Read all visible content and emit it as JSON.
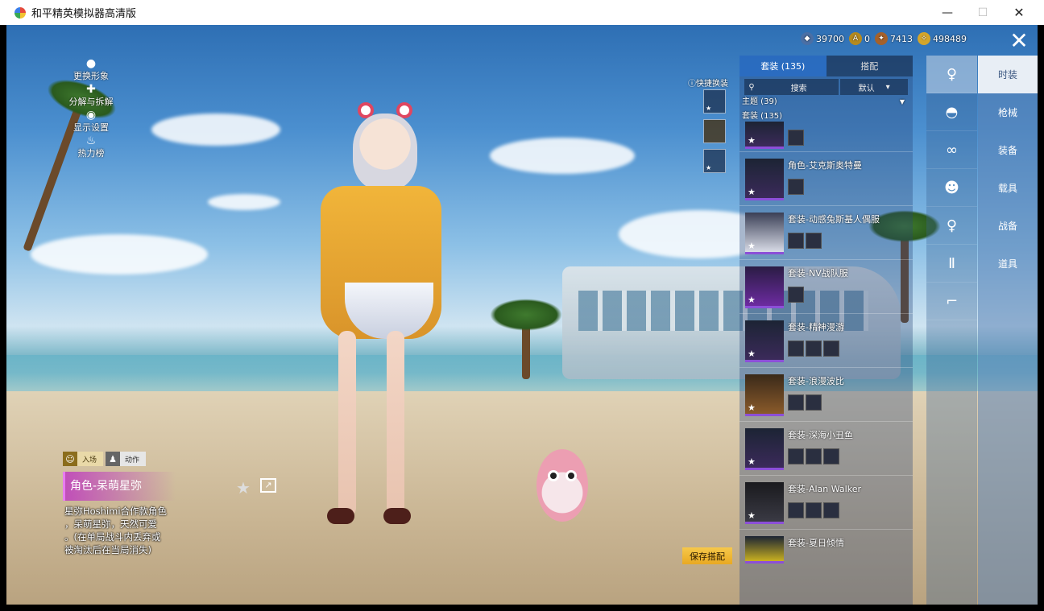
{
  "window": {
    "title": "和平精英模拟器高清版",
    "min_label": "—",
    "max_label": "☐",
    "close_label": "✕"
  },
  "left_menu": [
    {
      "label": "更换形象",
      "icon": "person-icon"
    },
    {
      "label": "分解与拆解",
      "icon": "puzzle-icon"
    },
    {
      "label": "显示设置",
      "icon": "eye-icon"
    },
    {
      "label": "热力榜",
      "icon": "flame-icon"
    }
  ],
  "currencies": [
    {
      "value": "39700",
      "icon": "coin-icon",
      "color": "#4a6fa5"
    },
    {
      "value": "0",
      "icon": "gold-coin-icon",
      "color": "#b58a1e"
    },
    {
      "value": "7413",
      "icon": "medal-icon",
      "color": "#a5612a"
    },
    {
      "value": "498489",
      "icon": "token-icon",
      "color": "#d4a52a"
    }
  ],
  "quick_change": {
    "label": "快捷换装"
  },
  "panel": {
    "tabs": [
      {
        "label": "套装 (135)",
        "active": true
      },
      {
        "label": "搭配",
        "active": false
      }
    ],
    "search_label": "搜索",
    "sort_label": "默认",
    "filter_theme": "主题 (39)",
    "filter_suits": "套装 (135)",
    "items": [
      {
        "name": "角色-艾克斯奥特曼",
        "subs": 1
      },
      {
        "name": "套装-动感兔斯基人偶服",
        "subs": 2
      },
      {
        "name": "套装-NV战队服",
        "subs": 1
      },
      {
        "name": "套装-精神漫游",
        "subs": 3
      },
      {
        "name": "套装-浪漫波比",
        "subs": 2
      },
      {
        "name": "套装-深海小丑鱼",
        "subs": 3
      },
      {
        "name": "套装-Alan Walker",
        "subs": 3
      },
      {
        "name": "套装-夏日倾情",
        "subs": 0
      }
    ]
  },
  "save_button": "保存搭配",
  "categories": [
    {
      "label": "时装",
      "active": true
    },
    {
      "label": "枪械",
      "active": false
    },
    {
      "label": "装备",
      "active": false
    },
    {
      "label": "载具",
      "active": false
    },
    {
      "label": "战备",
      "active": false
    },
    {
      "label": "道具",
      "active": false
    }
  ],
  "mode_tabs": [
    {
      "label": "入场"
    },
    {
      "label": "动作"
    }
  ],
  "character": {
    "name": "角色-呆萌星弥",
    "desc_line1": "星弥Hoshimi合作款角色",
    "desc_line2": "，呆萌星弥，天然可爱",
    "desc_line3": "。(在单局战斗内丢弃或",
    "desc_line4": "被淘汰后在当局消失)"
  },
  "colors": {
    "accent_blue": "#286ec8",
    "save_gold": "#e9a922",
    "rarity_purple": "#8c4fd8"
  }
}
